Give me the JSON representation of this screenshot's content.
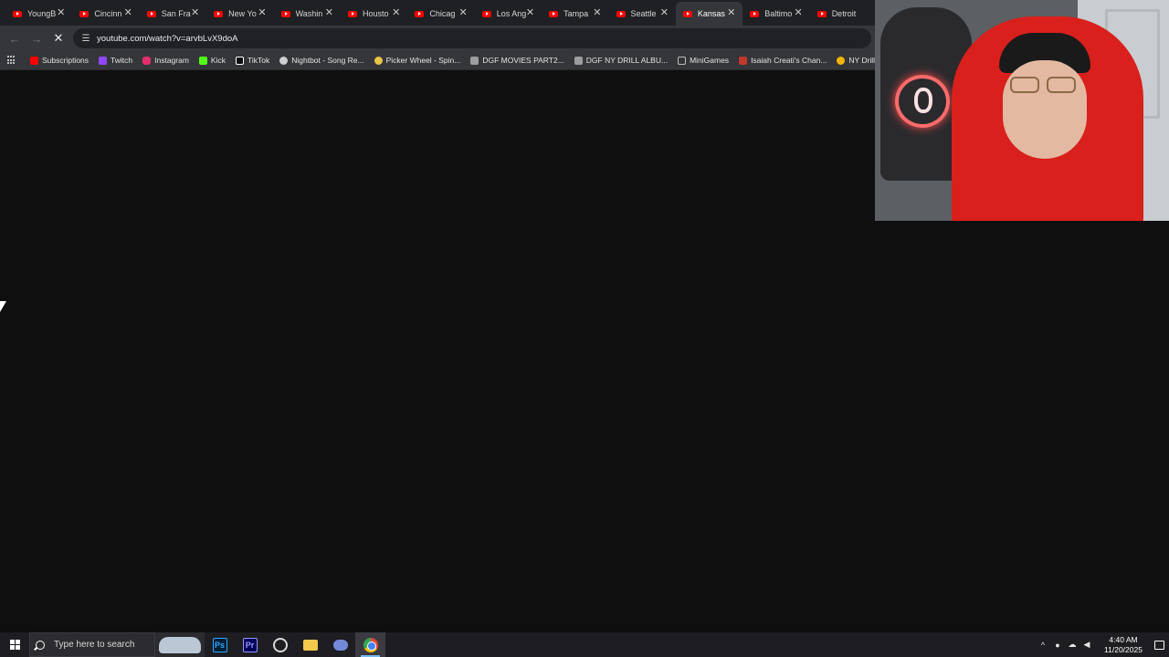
{
  "browser": {
    "tabs": [
      {
        "label": "YoungB",
        "active": false
      },
      {
        "label": "Cincinn",
        "active": false
      },
      {
        "label": "San Fra",
        "active": false
      },
      {
        "label": "New Yo",
        "active": false
      },
      {
        "label": "Washin",
        "active": false
      },
      {
        "label": "Housto",
        "active": false
      },
      {
        "label": "Chicag",
        "active": false
      },
      {
        "label": "Los Ang",
        "active": false
      },
      {
        "label": "Tampa",
        "active": false
      },
      {
        "label": "Seattle",
        "active": false
      },
      {
        "label": "Kansas",
        "active": true
      },
      {
        "label": "Baltimo",
        "active": false
      },
      {
        "label": "Detroit",
        "active": false
      }
    ],
    "close_glyph": "✕",
    "url": "youtube.com/watch?v=arvbLvX9doA",
    "back_glyph": "←",
    "forward_glyph": "→",
    "stop_glyph": "✕",
    "bookmarks": [
      {
        "label": "Subscriptions",
        "icon": "youtube-icon",
        "color": "#ff0000"
      },
      {
        "label": "Twitch",
        "icon": "twitch-icon",
        "color": "#9146ff"
      },
      {
        "label": "Instagram",
        "icon": "instagram-icon",
        "color": "#e1306c"
      },
      {
        "label": "Kick",
        "icon": "kick-icon",
        "color": "#53fc18"
      },
      {
        "label": "TikTok",
        "icon": "tiktok-icon",
        "color": "#ffffff"
      },
      {
        "label": "Nightbot - Song Re...",
        "icon": "nightbot-icon",
        "color": "#cfcfcf"
      },
      {
        "label": "Picker Wheel - Spin...",
        "icon": "wheel-icon",
        "color": "#e8c547"
      },
      {
        "label": "DGF MOVIES PART2...",
        "icon": "page-icon",
        "color": "#9e9e9e"
      },
      {
        "label": "DGF NY DRILL ALBU...",
        "icon": "page-icon",
        "color": "#9e9e9e"
      },
      {
        "label": "MiniGames",
        "icon": "folder-icon",
        "color": "#bdbdbd"
      },
      {
        "label": "Isaiah Creati's Chan...",
        "icon": "channel-icon",
        "color": "#c0392b"
      },
      {
        "label": "NY Drill Deads C",
        "icon": "bulb-icon",
        "color": "#f5b400"
      }
    ]
  },
  "taskbar": {
    "search_placeholder": "Type here to search",
    "apps": [
      {
        "name": "photoshop",
        "label": "Ps"
      },
      {
        "name": "premiere",
        "label": "Pr"
      },
      {
        "name": "obs",
        "label": ""
      },
      {
        "name": "file-explorer",
        "label": ""
      },
      {
        "name": "discord",
        "label": ""
      },
      {
        "name": "chrome",
        "label": ""
      }
    ],
    "tray": {
      "chevron": "^",
      "time": "4:40 AM",
      "date": "11/20/2025"
    }
  },
  "colors": {
    "tab_bg": "#1f2023",
    "toolbar_bg": "#35363a",
    "page_bg": "#0f0f0f",
    "taskbar_bg": "#1d1d22"
  }
}
